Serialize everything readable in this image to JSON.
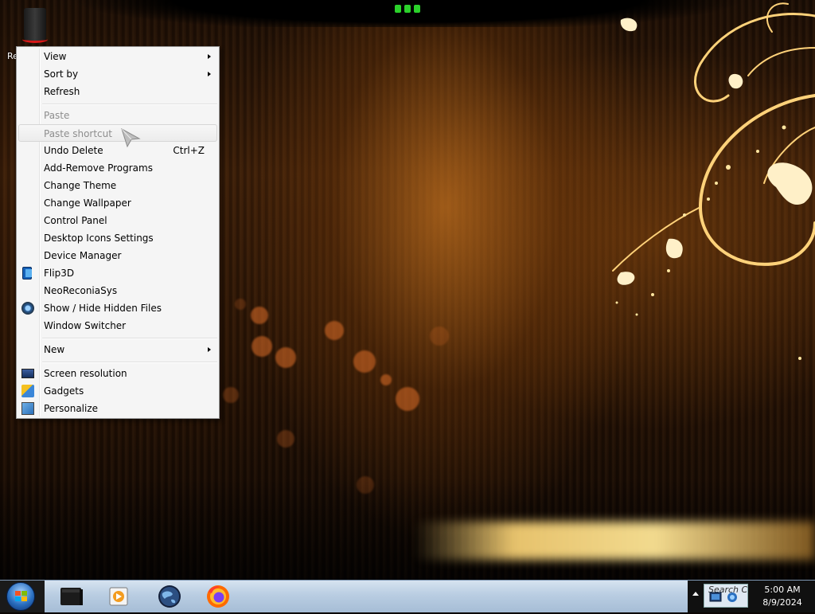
{
  "desktop": {
    "icon_label": "Re"
  },
  "context_menu": {
    "items": [
      {
        "label": "View",
        "submenu": true
      },
      {
        "label": "Sort by",
        "submenu": true
      },
      {
        "label": "Refresh"
      },
      {
        "label": "Paste",
        "disabled": true
      },
      {
        "label": "Paste shortcut",
        "disabled": true,
        "hovered": true
      },
      {
        "label": "Undo Delete",
        "shortcut": "Ctrl+Z"
      },
      {
        "label": "Add-Remove Programs"
      },
      {
        "label": "Change Theme"
      },
      {
        "label": "Change Wallpaper"
      },
      {
        "label": "Control Panel"
      },
      {
        "label": "Desktop Icons Settings"
      },
      {
        "label": "Device Manager"
      },
      {
        "label": "Flip3D",
        "icon": "flip3d-icon"
      },
      {
        "label": "NeoReconiaSys"
      },
      {
        "label": "Show / Hide Hidden Files",
        "icon": "eye-icon"
      },
      {
        "label": "Window Switcher"
      },
      {
        "label": "New",
        "submenu": true
      },
      {
        "label": "Screen resolution",
        "icon": "monitor-icon"
      },
      {
        "label": "Gadgets",
        "icon": "gadgets-icon"
      },
      {
        "label": "Personalize",
        "icon": "personalize-icon"
      }
    ]
  },
  "taskbar": {
    "pinned": [
      {
        "name": "terminal-icon"
      },
      {
        "name": "media-player-icon"
      },
      {
        "name": "globe-icon"
      },
      {
        "name": "firefox-icon"
      }
    ],
    "search_placeholder": "Search Co",
    "clock_time": "5:00 AM",
    "clock_date": "8/9/2024"
  },
  "colors": {
    "menu_bg": "#f5f5f5",
    "menu_border": "#979797",
    "disabled_text": "#8d8d8d",
    "taskbar_top": "#d6e3f0",
    "taskbar_bottom": "#a6bdd6",
    "accent_glow": "#ffd780"
  }
}
